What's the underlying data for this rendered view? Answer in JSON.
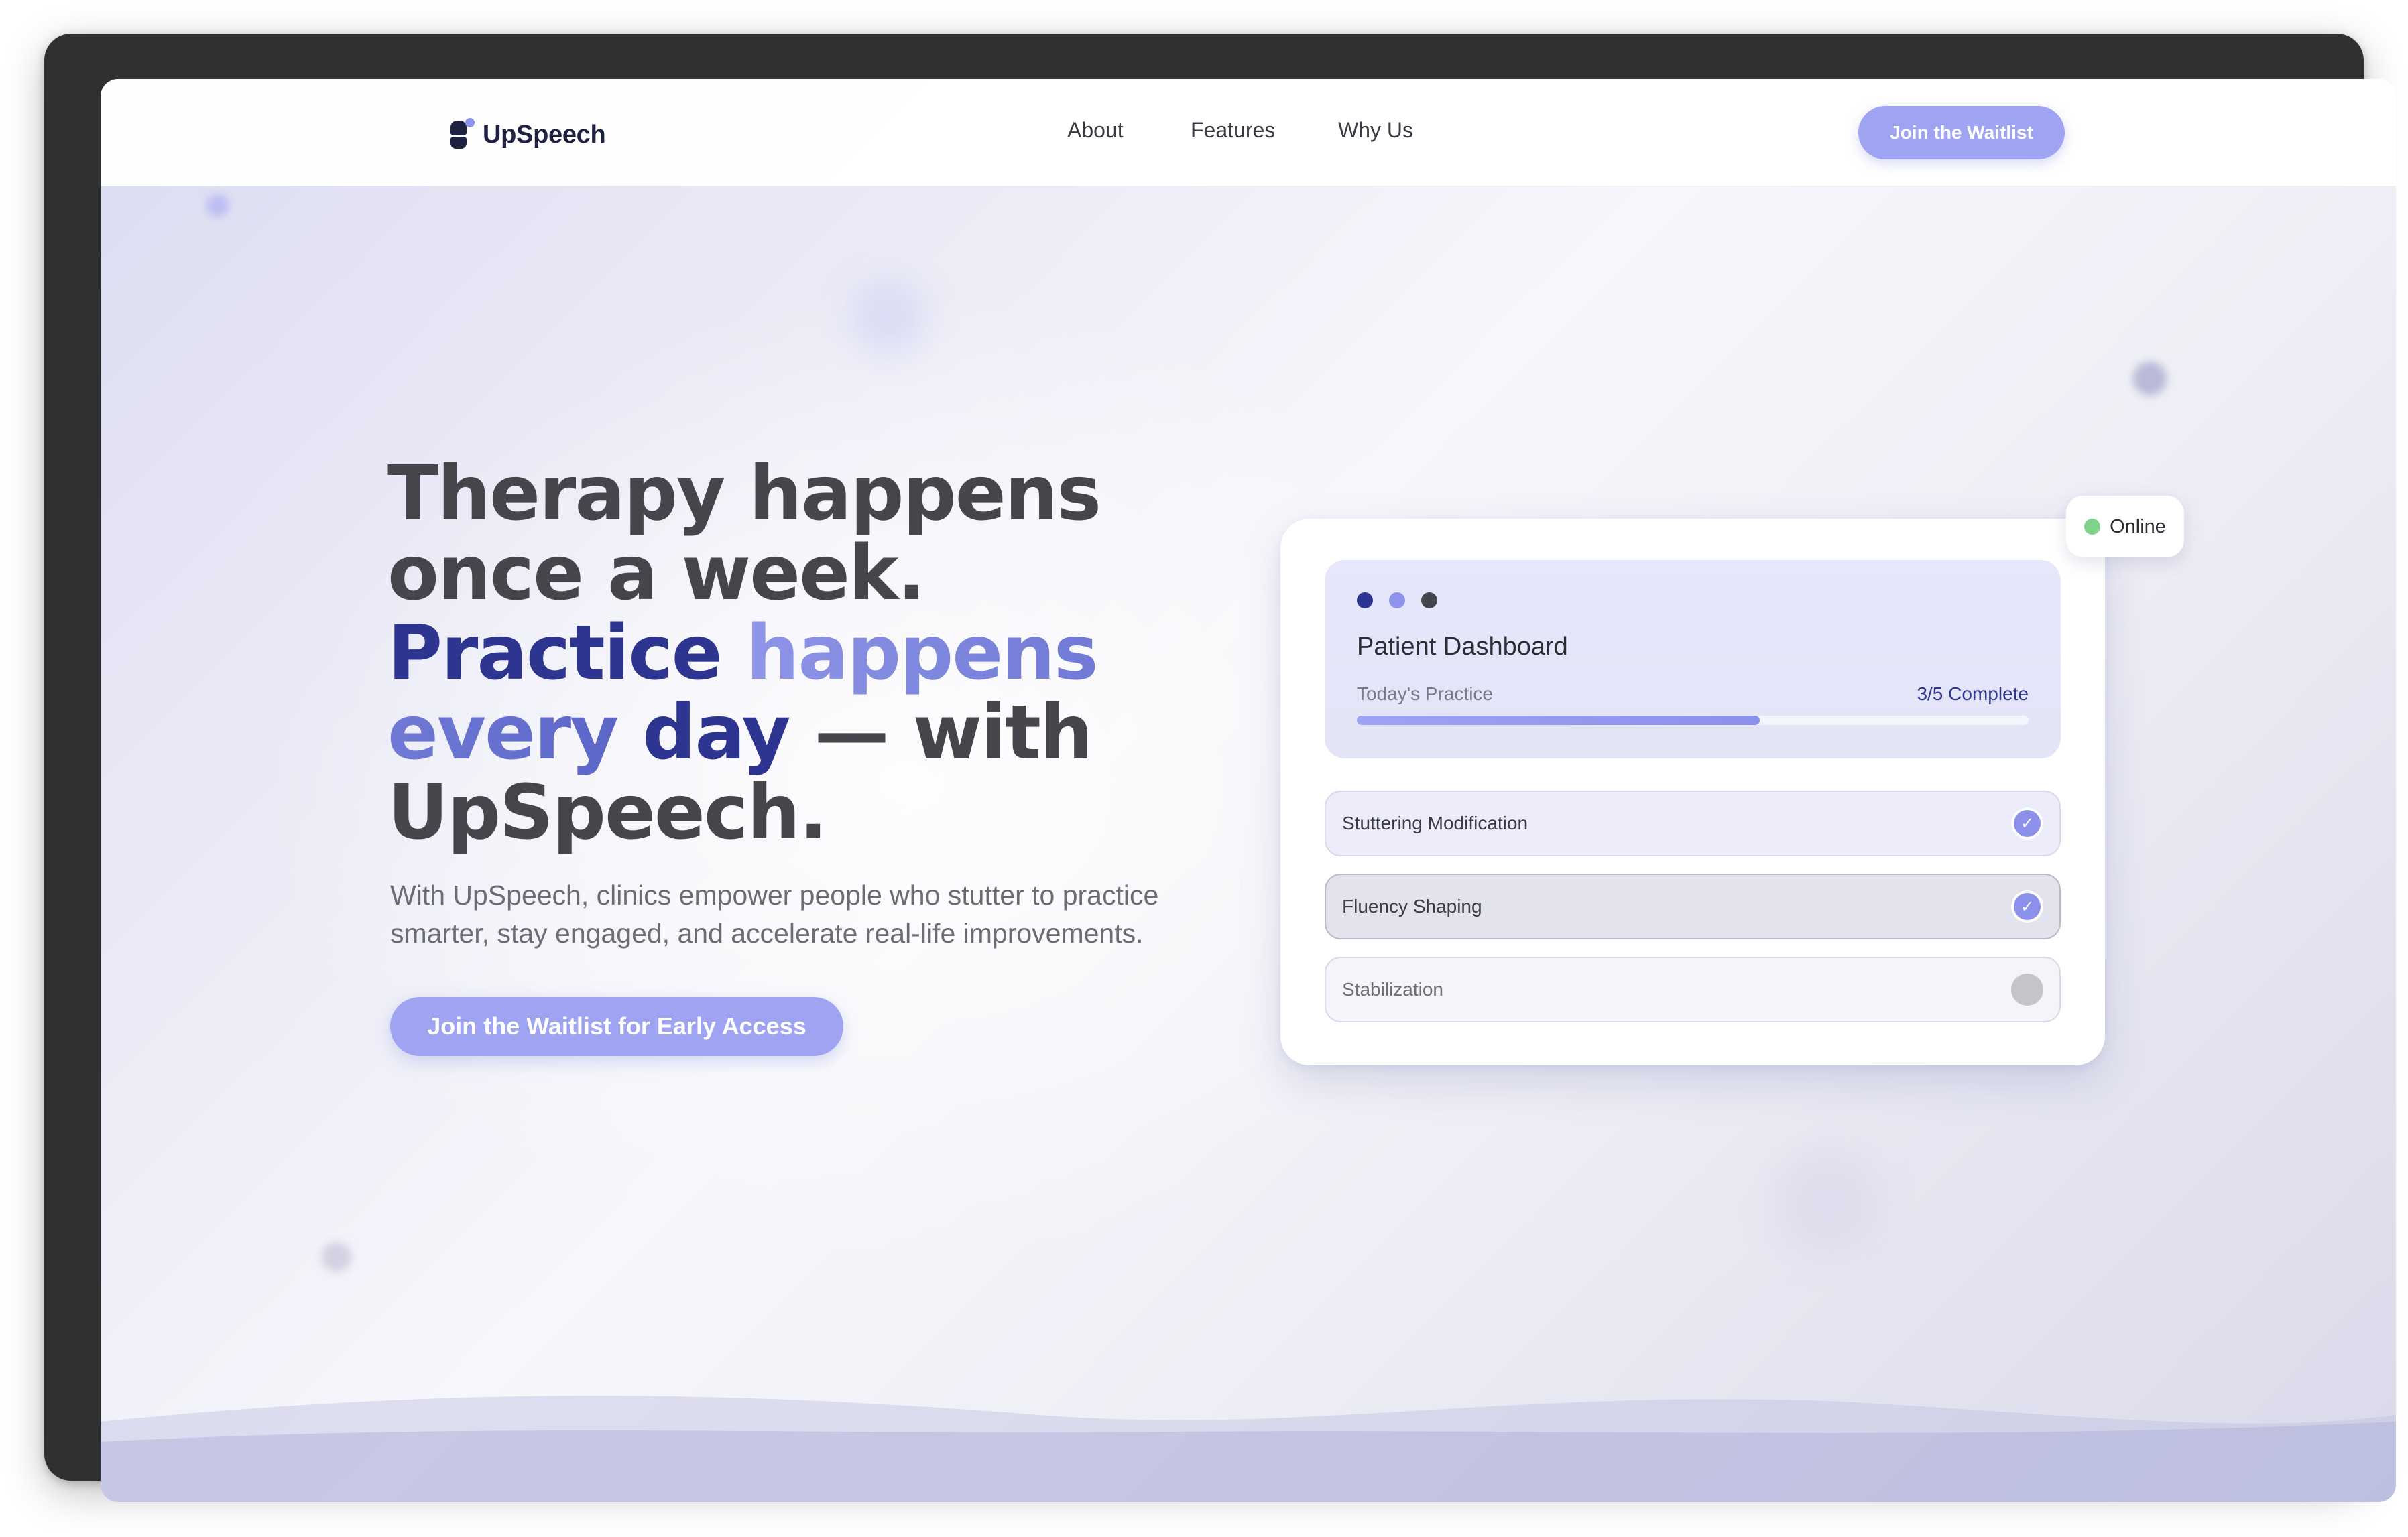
{
  "nav": {
    "brand": "UpSpeech",
    "links": [
      "About",
      "Features",
      "Why Us"
    ],
    "cta": "Join the Waitlist"
  },
  "hero": {
    "title_part1": "Therapy happens once a week.",
    "title_part2": "Practice",
    "title_part3": "happens every",
    "title_part4": "day",
    "title_part5": "— with UpSpeech.",
    "subtitle": "With UpSpeech, clinics empower people who stutter to practice smarter, stay engaged, and accelerate real-life improvements.",
    "cta": "Join the Waitlist for Early Access"
  },
  "dashboard": {
    "status": "Online",
    "title": "Patient Dashboard",
    "practice_label": "Today's Practice",
    "progress_text": "3/5 Complete",
    "progress_fraction": 0.6,
    "tasks": [
      {
        "label": "Stuttering Modification",
        "done": true,
        "check": "✓"
      },
      {
        "label": "Fluency Shaping",
        "done": true,
        "check": "✓"
      },
      {
        "label": "Stabilization",
        "done": false,
        "check": ""
      }
    ]
  },
  "colors": {
    "accent": "#9ea3f2",
    "brand_dark": "#2e3590",
    "online_green": "#7fd48a",
    "text_dark": "#45464b"
  },
  "icons": {
    "logo": "speech-logo-icon",
    "status": "status-dot-icon",
    "check": "check-icon"
  }
}
